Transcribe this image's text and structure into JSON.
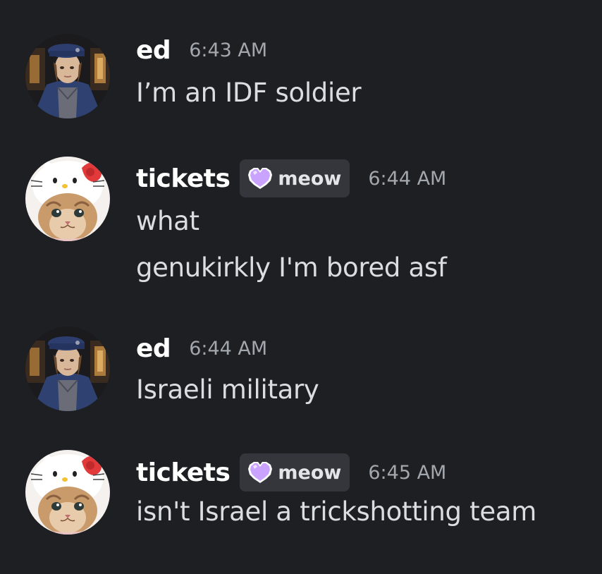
{
  "colors": {
    "background": "#1e1f22",
    "username": "#ffffff",
    "message_text": "#dbdee1",
    "timestamp": "#a2a6ad",
    "tag_background": "#35363c",
    "tag_heart": "#c9a3ff"
  },
  "messages": [
    {
      "username": "ed",
      "timestamp": "6:43 AM",
      "avatar_icon": "soldier-portrait-avatar",
      "lines": [
        "I’m an IDF soldier"
      ]
    },
    {
      "username": "tickets",
      "tag": {
        "icon": "pixel-heart-icon",
        "label": "meow"
      },
      "timestamp": "6:44 AM",
      "avatar_icon": "cat-hello-kitty-hat-avatar",
      "lines": [
        "what",
        "genukirkly I'm bored asf"
      ]
    },
    {
      "username": "ed",
      "timestamp": "6:44 AM",
      "avatar_icon": "soldier-portrait-avatar",
      "lines": [
        "Israeli military"
      ]
    },
    {
      "username": "tickets",
      "tag": {
        "icon": "pixel-heart-icon",
        "label": "meow"
      },
      "timestamp": "6:45 AM",
      "avatar_icon": "cat-hello-kitty-hat-avatar",
      "lines": [
        "isn't Israel a trickshotting team"
      ]
    }
  ]
}
